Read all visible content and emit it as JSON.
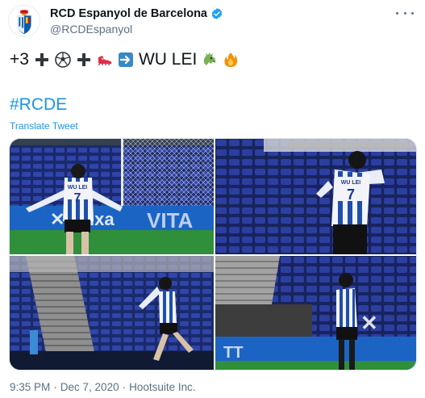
{
  "account": {
    "display_name": "RCD Espanyol de Barcelona",
    "handle": "@RCDEspanyol",
    "verified_icon": "verified-badge-icon",
    "avatar_icon": "club-crest-icon"
  },
  "tweet": {
    "prefix": "+3",
    "emoji_sequence": [
      "heavy-plus-icon",
      "soccer-ball-icon",
      "heavy-plus-icon",
      "boot-icon",
      "right-arrow-icon"
    ],
    "player_name": "WU LEI",
    "trailing_emojis": [
      "dragon-face-icon",
      "fire-icon"
    ],
    "hashtag": "#RCDE",
    "translate_label": "Translate Tweet"
  },
  "media": {
    "photos": [
      {
        "name": "photo-celebration-arms-out"
      },
      {
        "name": "photo-celebration-back-view"
      },
      {
        "name": "photo-running-celebration"
      },
      {
        "name": "photo-walking-sideline"
      }
    ],
    "shirt_label": "WU LEI",
    "shirt_number": "7"
  },
  "footer": {
    "time": "9:35 PM",
    "separator1": "·",
    "date": "Dec 7, 2020",
    "separator2": "·",
    "source": "Hootsuite Inc."
  },
  "colors": {
    "accent": "#1b95e0",
    "text": "#0f1419",
    "muted": "#5b7083",
    "club_blue": "#0a5bab"
  }
}
